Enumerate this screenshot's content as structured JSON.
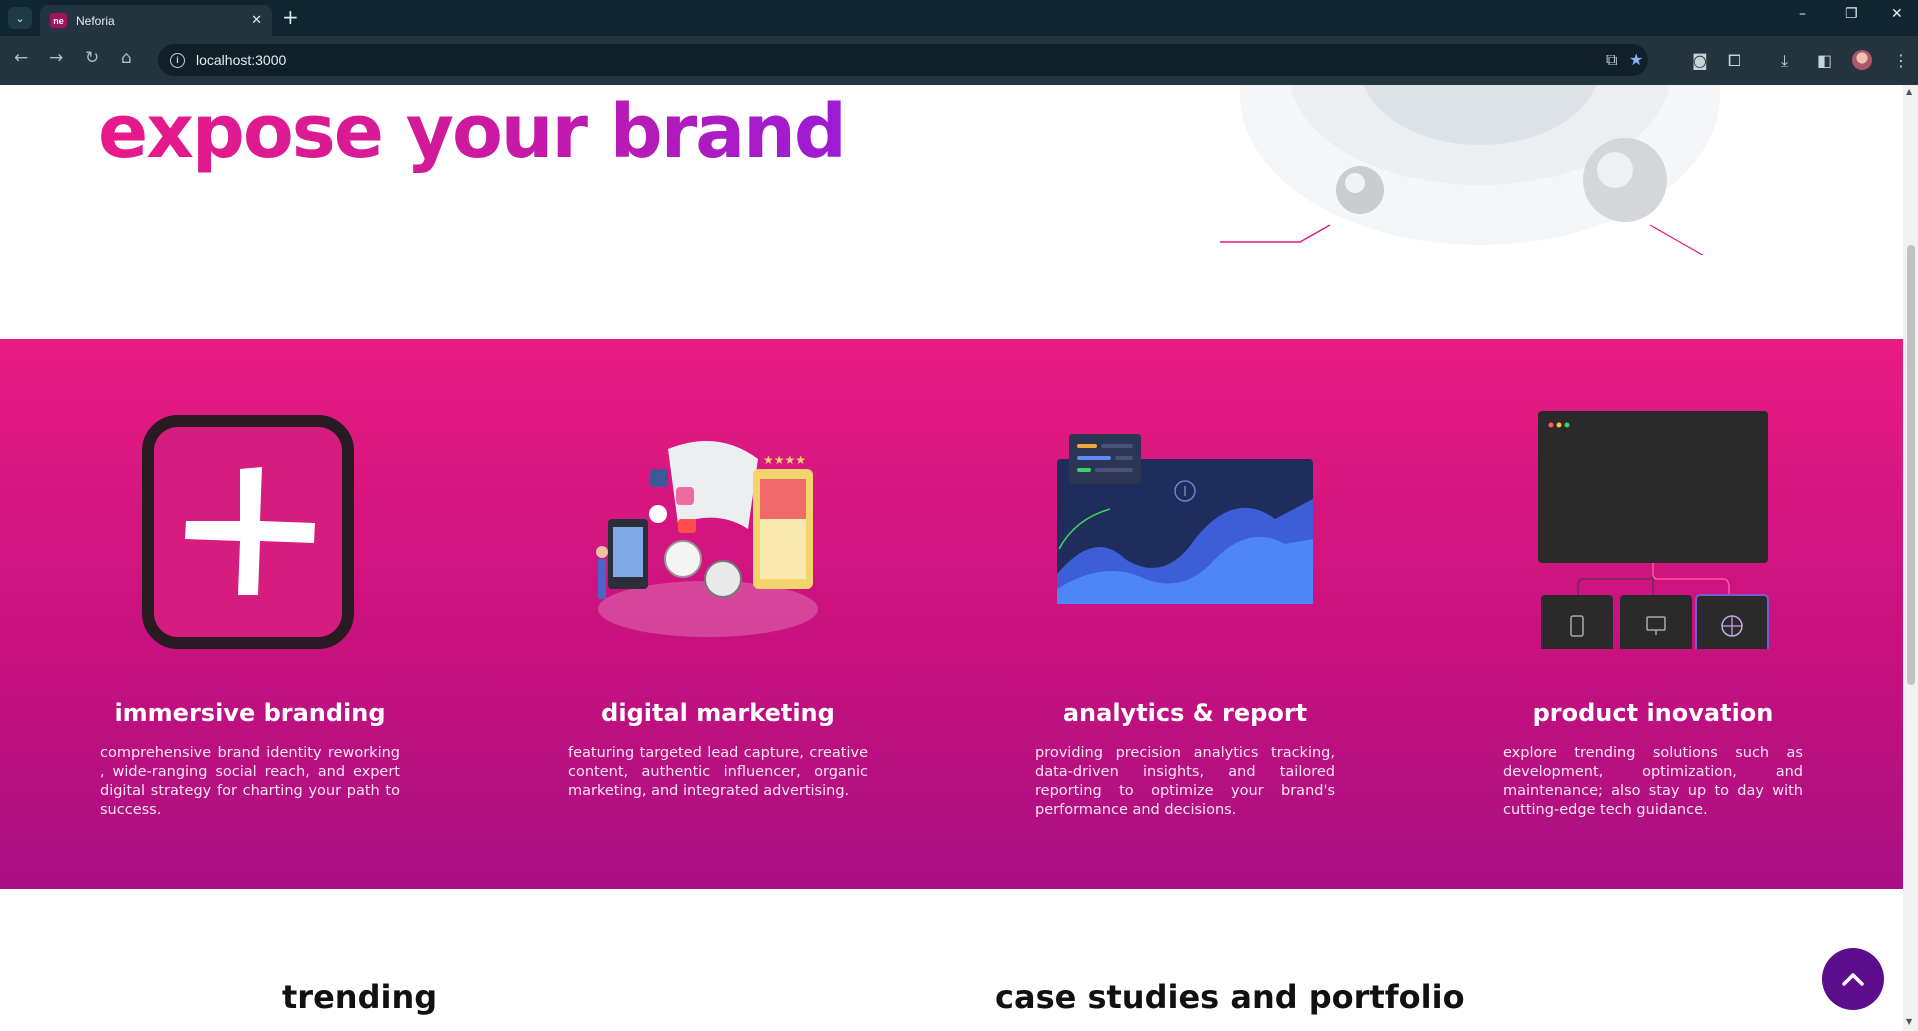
{
  "browser": {
    "tab_title": "Neforia",
    "favicon_text": "ne",
    "url": "localhost:3000",
    "icons": {
      "tab_menu": "chevron-down-icon",
      "close_tab": "close-icon",
      "new_tab": "plus-icon",
      "back": "arrow-left-icon",
      "forward": "arrow-right-icon",
      "reload": "reload-icon",
      "home": "home-icon",
      "site_info": "info-icon",
      "install": "install-app-icon",
      "bookmark": "star-icon",
      "screenshot": "camera-icon",
      "extensions": "puzzle-icon",
      "downloads": "download-icon",
      "side_panel": "side-panel-icon",
      "menu": "kebab-menu-icon"
    },
    "window_controls": {
      "minimize": "–",
      "restore": "❐",
      "close": "✕"
    }
  },
  "hero": {
    "heading": "expose your brand"
  },
  "services": [
    {
      "title": "immersive branding",
      "description": "comprehensive brand identity reworking , wide-ranging social reach, and expert digital strategy for charting your path to success.",
      "icon": "branding-plus-illustration"
    },
    {
      "title": "digital marketing",
      "description": "featuring targeted lead capture, creative content, authentic influencer, organic marketing, and integrated advertising.",
      "icon": "marketing-isometric-illustration"
    },
    {
      "title": "analytics & report",
      "description": "providing precision analytics tracking, data-driven insights, and tailored reporting to optimize your brand's performance and decisions.",
      "icon": "analytics-chart-illustration"
    },
    {
      "title": "product inovation",
      "description": "explore trending solutions such as development, optimization, and maintenance; also stay up to day with cutting-edge tech guidance.",
      "icon": "devices-illustration"
    }
  ],
  "sections": {
    "trending": "trending",
    "case_studies": "case studies and portfolio"
  },
  "scroll_top": {
    "icon": "chevron-up-icon"
  },
  "colors": {
    "chrome_dark": "#0f2530",
    "chrome_toolbar": "#22353f",
    "services_gradient_top": "#e81c82",
    "services_gradient_bottom": "#a90f82",
    "heading_pink": "#e8198b",
    "heading_purple": "#9b1bd6",
    "scroll_top_bg": "#5c0d8c"
  }
}
